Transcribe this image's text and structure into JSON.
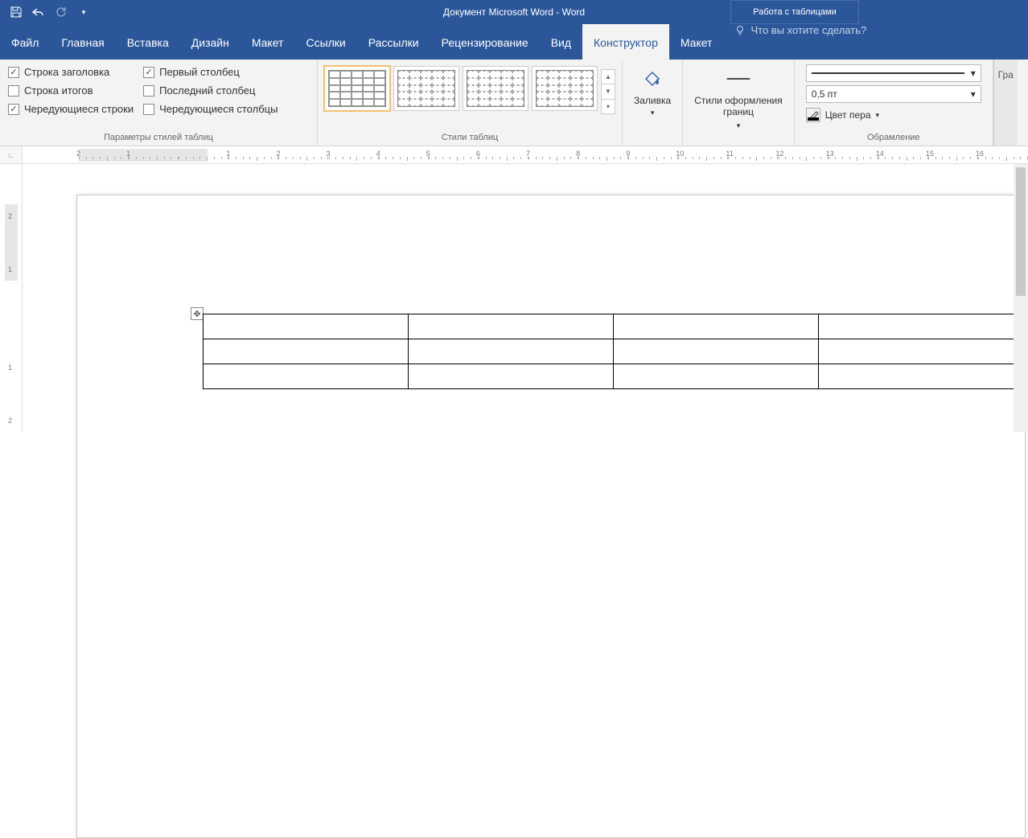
{
  "titlebar": {
    "title": "Документ Microsoft Word - Word",
    "table_context": "Работа с таблицами"
  },
  "tabs": {
    "file": "Файл",
    "home": "Главная",
    "insert": "Вставка",
    "design": "Дизайн",
    "layout": "Макет",
    "references": "Ссылки",
    "mailings": "Рассылки",
    "review": "Рецензирование",
    "view": "Вид",
    "constructor": "Конструктор",
    "tlayout": "Макет",
    "tellme": "Что вы хотите сделать?"
  },
  "ribbon": {
    "style_options": {
      "header_row": "Строка заголовка",
      "total_row": "Строка итогов",
      "banded_rows": "Чередующиеся строки",
      "first_col": "Первый столбец",
      "last_col": "Последний столбец",
      "banded_cols": "Чередующиеся столбцы",
      "group_label": "Параметры стилей таблиц",
      "checked": {
        "header_row": true,
        "total_row": false,
        "banded_rows": true,
        "first_col": true,
        "last_col": false,
        "banded_cols": false
      }
    },
    "table_styles": {
      "group_label": "Стили таблиц"
    },
    "shading": {
      "label": "Заливка"
    },
    "border_styles": {
      "label": "Стили оформления\nграниц"
    },
    "borders": {
      "weight": "0,5 пт",
      "pen_color": "Цвет пера",
      "group_label": "Обрамление",
      "gra": "Гра"
    }
  },
  "ruler": {
    "h_numbers": [
      "2",
      "1",
      "",
      "1",
      "2",
      "3",
      "4",
      "5",
      "6",
      "7",
      "8",
      "9",
      "10",
      "11",
      "12",
      "13",
      "14",
      "15",
      "16"
    ],
    "v_numbers": [
      "2",
      "1",
      "",
      "1",
      "2"
    ]
  },
  "document": {
    "table": {
      "rows": 3,
      "cols": 4
    }
  }
}
